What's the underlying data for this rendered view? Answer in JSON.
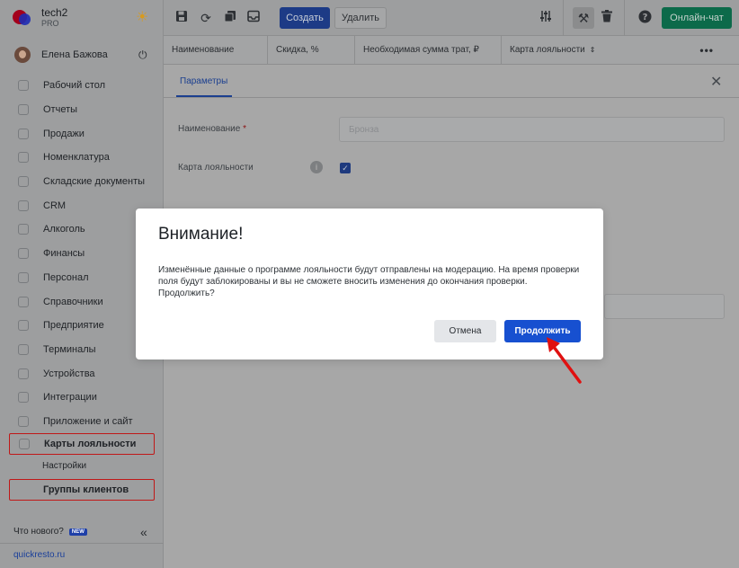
{
  "brand": {
    "name": "tech2",
    "plan": "PRO"
  },
  "user": {
    "name": "Елена Бажова"
  },
  "sidebar": {
    "items": [
      {
        "label": "Рабочий стол"
      },
      {
        "label": "Отчеты"
      },
      {
        "label": "Продажи"
      },
      {
        "label": "Номенклатура"
      },
      {
        "label": "Складские документы"
      },
      {
        "label": "CRM"
      },
      {
        "label": "Алкоголь"
      },
      {
        "label": "Финансы"
      },
      {
        "label": "Персонал"
      },
      {
        "label": "Справочники"
      },
      {
        "label": "Предприятие"
      },
      {
        "label": "Терминалы"
      },
      {
        "label": "Устройства"
      },
      {
        "label": "Интеграции"
      },
      {
        "label": "Приложение и сайт"
      }
    ],
    "loyalty": {
      "label": "Карты лояльности",
      "sub_label": "Настройки"
    },
    "client_groups": {
      "label": "Группы клиентов"
    },
    "whats_new": "Что нового?",
    "new_badge": "NEW",
    "site_link": "quickresto.ru"
  },
  "toolbar": {
    "create_label": "Создать",
    "delete_label": "Удалить",
    "chat_label": "Онлайн-чат",
    "chat_color": "#0f8a5f",
    "accent_color": "#1750d0"
  },
  "table": {
    "columns": [
      "Наименование",
      "Скидка, %",
      "Необходимая сумма трат, ₽",
      "Карта лояльности"
    ],
    "more": "•••"
  },
  "panel": {
    "tab": "Параметры",
    "name_label": "Наименование",
    "required_mark": "*",
    "name_placeholder": "Бронза",
    "loyalty_label": "Карта лояльности",
    "loyalty_checked": true
  },
  "modal": {
    "title": "Внимание!",
    "body": "Изменённые данные о программе лояльности будут отправлены на модерацию. На время проверки поля будут заблокированы и вы не сможете вносить изменения до окончания проверки. Продолжить?",
    "cancel_label": "Отмена",
    "continue_label": "Продолжить"
  }
}
